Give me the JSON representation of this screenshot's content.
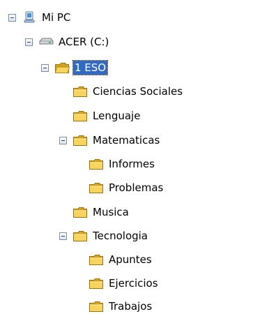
{
  "tree": {
    "root": {
      "label": "Mi PC",
      "icon": "computer-icon",
      "expanded": true
    },
    "drive": {
      "label": "ACER (C:)",
      "icon": "drive-icon",
      "expanded": true
    },
    "selected_folder": {
      "label": "1 ESO",
      "icon": "folder-open-icon",
      "expanded": true,
      "selected": true
    },
    "folders": [
      {
        "label": "Ciencias Sociales",
        "icon": "folder-icon"
      },
      {
        "label": "Lenguaje",
        "icon": "folder-icon"
      },
      {
        "label": "Matematicas",
        "icon": "folder-icon",
        "expanded": true
      },
      {
        "label": "Informes",
        "icon": "folder-icon"
      },
      {
        "label": "Problemas",
        "icon": "folder-icon"
      },
      {
        "label": "Musica",
        "icon": "folder-icon"
      },
      {
        "label": "Tecnologia",
        "icon": "folder-icon",
        "expanded": true
      },
      {
        "label": "Apuntes",
        "icon": "folder-icon"
      },
      {
        "label": "Ejercicios",
        "icon": "folder-icon"
      },
      {
        "label": "Trabajos",
        "icon": "folder-icon"
      }
    ]
  },
  "colors": {
    "selection": "#316ac5",
    "folder": "#f6d45e",
    "folder_dark": "#d8a31c",
    "expander_border": "#7b8ea8"
  }
}
